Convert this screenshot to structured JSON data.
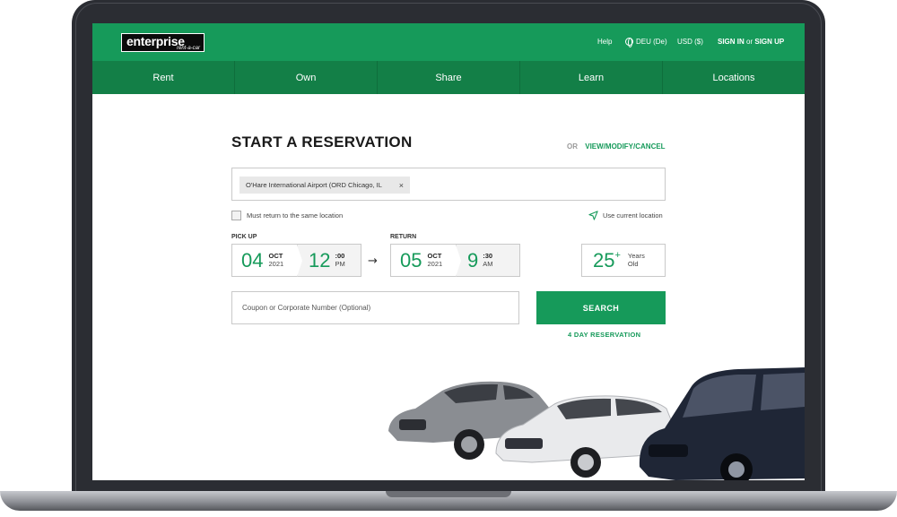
{
  "brand": {
    "name": "enterprise",
    "tagline": "rent-a-car"
  },
  "header": {
    "help": "Help",
    "language": "DEU (De)",
    "currency": "USD ($)",
    "sign_in": "SIGN IN",
    "or": "or",
    "sign_up": "SIGN UP"
  },
  "nav": {
    "items": [
      "Rent",
      "Own",
      "Share",
      "Learn",
      "Locations"
    ]
  },
  "form": {
    "title": "START A RESERVATION",
    "alt_or": "OR",
    "alt_link": "VIEW/MODIFY/CANCEL",
    "location_value": "O'Hare International Airport (ORD Chicago, IL",
    "location_clear": "×",
    "same_location_label": "Must return to the same location",
    "same_location_checked": false,
    "current_location_label": "Use current location",
    "pickup": {
      "label": "PICK UP",
      "day": "04",
      "month": "OCT",
      "year": "2021",
      "hour": "12",
      "minutes": ":00",
      "ampm": "PM"
    },
    "return": {
      "label": "RETURN",
      "day": "05",
      "month": "OCT",
      "year": "2021",
      "hour": "9",
      "minutes": ":30",
      "ampm": "AM"
    },
    "age": {
      "value": "25",
      "plus": "+",
      "line1": "Years",
      "line2": "Old"
    },
    "coupon_placeholder": "Coupon or Corporate Number (Optional)",
    "search_label": "SEARCH",
    "duration_link": "4 DAY RESERVATION"
  },
  "colors": {
    "primary_green": "#169a5a",
    "nav_green": "#137f47"
  },
  "icons": {
    "language": "globe-icon",
    "current_location": "location-arrow-icon",
    "arrow": "arrow-right-icon"
  }
}
